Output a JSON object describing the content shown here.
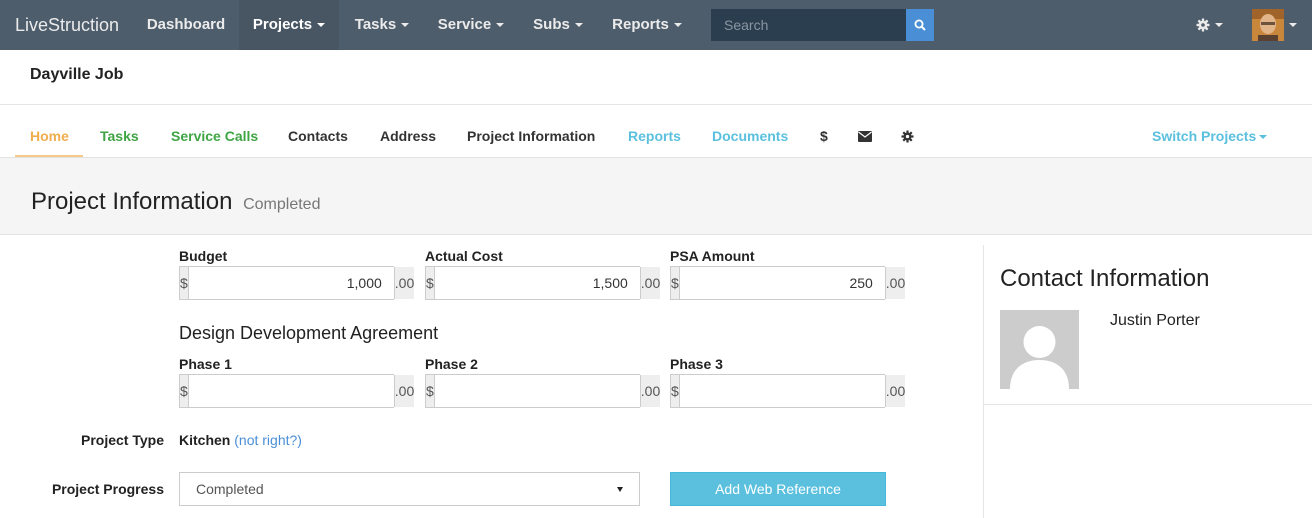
{
  "nav": {
    "brand": "LiveStruction",
    "items": [
      {
        "label": "Dashboard"
      },
      {
        "label": "Projects"
      },
      {
        "label": "Tasks"
      },
      {
        "label": "Service"
      },
      {
        "label": "Subs"
      },
      {
        "label": "Reports"
      }
    ],
    "search_placeholder": "Search"
  },
  "page": {
    "job_title": "Dayville Job"
  },
  "subnav": {
    "home": "Home",
    "tasks": "Tasks",
    "service_calls": "Service Calls",
    "contacts": "Contacts",
    "address": "Address",
    "project_information": "Project Information",
    "reports": "Reports",
    "documents": "Documents",
    "dollar": "$",
    "switch_projects": "Switch Projects"
  },
  "section": {
    "title": "Project Information",
    "status": "Completed"
  },
  "form": {
    "budget": {
      "label": "Budget",
      "prefix": "$",
      "value": "1,000",
      "suffix": ".00"
    },
    "actual_cost": {
      "label": "Actual Cost",
      "prefix": "$",
      "value": "1,500",
      "suffix": ".00"
    },
    "psa_amount": {
      "label": "PSA Amount",
      "prefix": "$",
      "value": "250",
      "suffix": ".00"
    },
    "dda_heading": "Design Development Agreement",
    "phase1": {
      "label": "Phase 1",
      "prefix": "$",
      "value": "",
      "suffix": ".00"
    },
    "phase2": {
      "label": "Phase 2",
      "prefix": "$",
      "value": "",
      "suffix": ".00"
    },
    "phase3": {
      "label": "Phase 3",
      "prefix": "$",
      "value": "",
      "suffix": ".00"
    },
    "project_type_label": "Project Type",
    "project_type_value": "Kitchen",
    "project_type_link_open": "(",
    "project_type_link": "not right?",
    "project_type_link_close": ")",
    "project_progress_label": "Project Progress",
    "project_progress_value": "Completed",
    "add_web_reference": "Add Web Reference"
  },
  "contact": {
    "title": "Contact Information",
    "name": "Justin Porter"
  },
  "colors": {
    "navbar": "#4e5d6c",
    "accent_orange": "#f0ad4e",
    "green": "#3fa544",
    "info_blue": "#5bc0de",
    "link_blue": "#4a8fd6"
  }
}
